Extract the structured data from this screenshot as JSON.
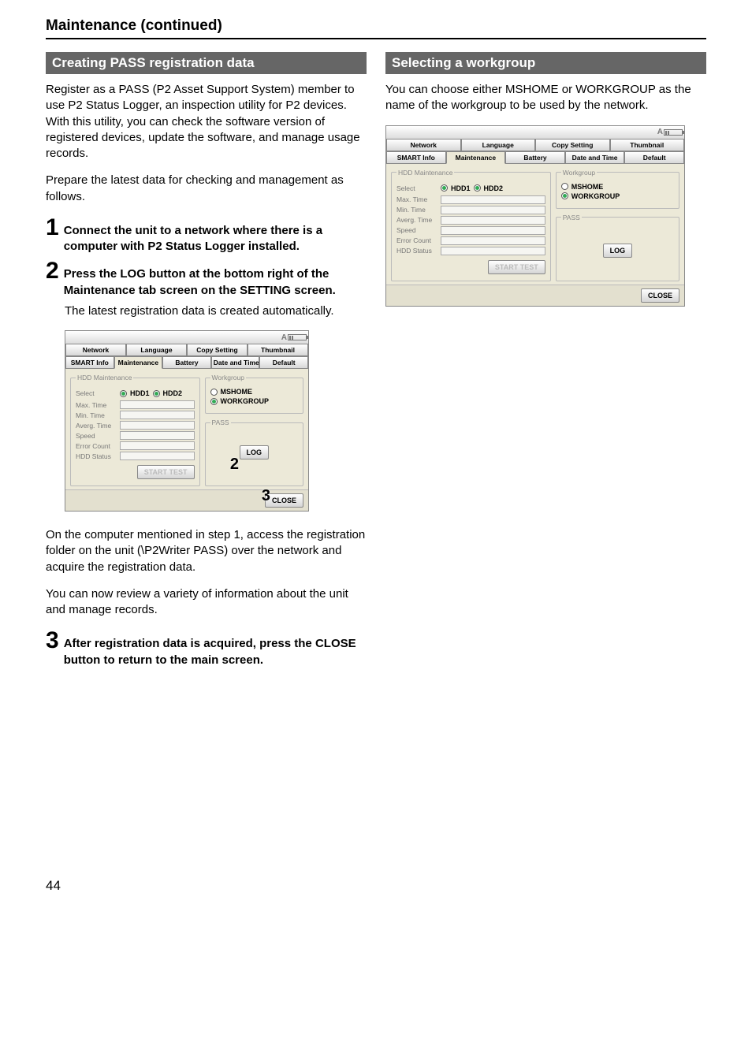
{
  "page_number": "44",
  "section_title": "Maintenance (continued)",
  "left": {
    "header": "Creating PASS registration data",
    "intro1": "Register as a PASS (P2 Asset Support System) member to use P2 Status Logger, an inspection utility for P2 devices. With this utility, you can check the software version of registered devices, update the software, and manage usage records.",
    "intro2": "Prepare the latest data for checking and management as follows.",
    "step1_num": "1",
    "step1_txt": "Connect the unit to a network where there is a computer with P2 Status Logger installed.",
    "step2_num": "2",
    "step2_txt": "Press the LOG button at the bottom right of the Maintenance tab screen on the SETTING screen.",
    "step2_note": "The latest registration data is created automatically.",
    "post1": "On the computer mentioned in step 1, access the registration folder on the unit (\\P2Writer PASS) over the network and acquire the registration data.",
    "post2": "You can now review a variety of information about the unit and manage records.",
    "step3_num": "3",
    "step3_txt": "After registration data is acquired, press the CLOSE button to return to the main screen.",
    "callout2": "2",
    "callout3": "3"
  },
  "right": {
    "header": "Selecting a workgroup",
    "intro": "You can choose either MSHOME or WORKGROUP as the name of the workgroup to be used by the network."
  },
  "window": {
    "title_a": "A",
    "tabs_row1": {
      "network": "Network",
      "language": "Language",
      "copy": "Copy Setting",
      "thumb": "Thumbnail"
    },
    "tabs_row2": {
      "smart": "SMART Info",
      "maint": "Maintenance",
      "battery": "Battery",
      "datetime": "Date and Time",
      "def": "Default"
    },
    "hdd_legend": "HDD Maintenance",
    "hdd_select": "Select",
    "hdd1": "HDD1",
    "hdd2": "HDD2",
    "rows": {
      "max": "Max. Time",
      "min": "Min. Time",
      "avg": "Averg. Time",
      "speed": "Speed",
      "err": "Error Count",
      "stat": "HDD Status"
    },
    "start": "START TEST",
    "wg_legend": "Workgroup",
    "mshome": "MSHOME",
    "workgroup": "WORKGROUP",
    "pass_legend": "PASS",
    "log": "LOG",
    "close": "CLOSE"
  }
}
